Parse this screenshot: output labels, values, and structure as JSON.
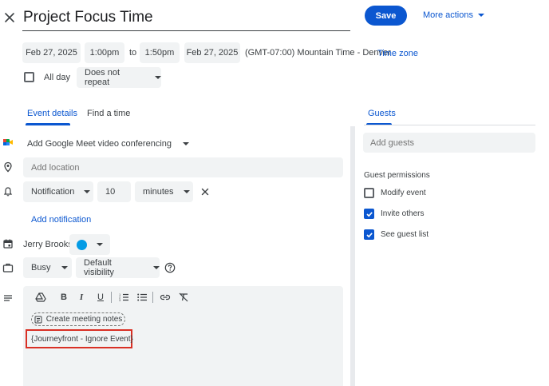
{
  "header": {
    "title": "Project Focus Time",
    "save_label": "Save",
    "more_actions_label": "More actions"
  },
  "date_row": {
    "start_date": "Feb 27, 2025",
    "start_time": "1:00pm",
    "to_label": "to",
    "end_time": "1:50pm",
    "end_date": "Feb 27, 2025",
    "timezone_text": "(GMT-07:00) Mountain Time - Denver",
    "timezone_link": "Time zone"
  },
  "options_row": {
    "all_day_label": "All day",
    "all_day_checked": false,
    "repeat_label": "Does not repeat"
  },
  "tabs": [
    {
      "label": "Event details",
      "active": true
    },
    {
      "label": "Find a time",
      "active": false
    }
  ],
  "guests_tab_label": "Guests",
  "details": {
    "meet_label": "Add Google Meet video conferencing",
    "location_placeholder": "Add location",
    "notification_type": "Notification",
    "notification_value": "10",
    "notification_unit": "minutes",
    "add_notification_label": "Add notification",
    "owner_name": "Jerry Brooks",
    "event_color": "#039be5",
    "availability": "Busy",
    "visibility": "Default visibility"
  },
  "editor": {
    "toolbar": [
      "drive-icon",
      "bold-icon",
      "italic-icon",
      "underline-icon",
      "numbered-list-icon",
      "bulleted-list-icon",
      "link-icon",
      "remove-formatting-icon"
    ],
    "meeting_notes_label": "Create meeting notes",
    "description_text": "{Journeyfront - Ignore Event}"
  },
  "guests": {
    "add_placeholder": "Add guests",
    "permissions_title": "Guest permissions",
    "permissions": [
      {
        "label": "Modify event",
        "checked": false
      },
      {
        "label": "Invite others",
        "checked": true
      },
      {
        "label": "See guest list",
        "checked": true
      }
    ]
  },
  "colors": {
    "accent": "#0b57d0",
    "field_bg": "#f1f3f4",
    "highlight": "#d93025"
  }
}
